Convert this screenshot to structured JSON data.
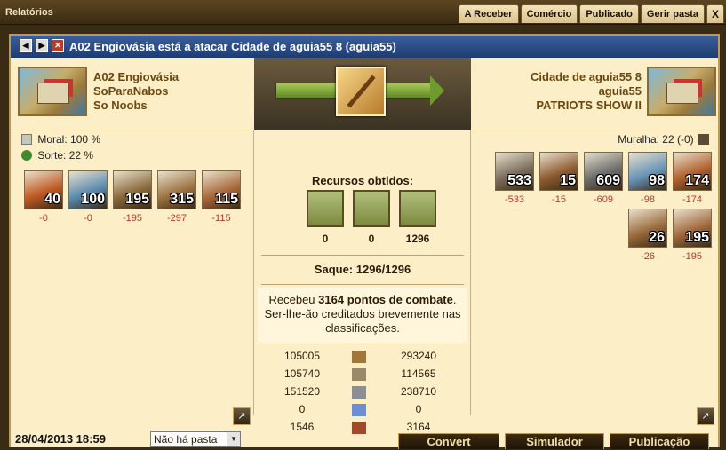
{
  "window": {
    "title": "Relatórios"
  },
  "tabs": [
    "A Receber",
    "Comércio",
    "Publicado",
    "Gerir pasta",
    "X"
  ],
  "report": {
    "title": "A02 Engiovásia está a atacar Cidade de aguia55 8 (aguia55)",
    "nav_prev": "◀",
    "nav_next": "▶",
    "nav_close": "✕"
  },
  "attacker": {
    "city": "A02 Engiovásia",
    "player": "SoParaNabos",
    "alliance": "So Noobs",
    "moral_label": "Moral: 100 %",
    "sorte_label": "Sorte: 22 %",
    "units": [
      {
        "icon": "fire-ship-icon",
        "count": "40",
        "loss": "-0",
        "color": "#c05a24"
      },
      {
        "icon": "transport-boat-icon",
        "count": "100",
        "loss": "-0",
        "color": "#5b8bb0"
      },
      {
        "icon": "hoplite-icon",
        "count": "195",
        "loss": "-195",
        "color": "#8a6a3c"
      },
      {
        "icon": "slinger-icon",
        "count": "315",
        "loss": "-297",
        "color": "#9c7240"
      },
      {
        "icon": "swordsman-icon",
        "count": "115",
        "loss": "-115",
        "color": "#a86a3a"
      }
    ]
  },
  "defender": {
    "city": "Cidade de aguia55 8",
    "player": "aguia55",
    "alliance": "PATRIOTS SHOW II",
    "wall_label": "Muralha: 22 (-0)",
    "units": [
      {
        "icon": "archer-icon",
        "count": "533",
        "loss": "-533",
        "color": "#7a6c5c"
      },
      {
        "icon": "swordsman-icon",
        "count": "15",
        "loss": "-15",
        "color": "#8c5a30"
      },
      {
        "icon": "hoplite-icon",
        "count": "609",
        "loss": "-609",
        "color": "#6c6c6c"
      },
      {
        "icon": "transport-boat-icon",
        "count": "98",
        "loss": "-98",
        "color": "#6a95b8"
      },
      {
        "icon": "fire-ship-icon",
        "count": "174",
        "loss": "-174",
        "color": "#b0602c"
      },
      {
        "icon": "slinger-icon",
        "count": "26",
        "loss": "-26",
        "color": "#9a6a3a"
      },
      {
        "icon": "swordsman-icon",
        "count": "195",
        "loss": "-195",
        "color": "#a0683c"
      }
    ]
  },
  "resources": {
    "title": "Recursos obtidos:",
    "items": [
      {
        "icon": "wood-icon",
        "value": "0"
      },
      {
        "icon": "stone-icon",
        "value": "0"
      },
      {
        "icon": "silver-icon",
        "value": "1296"
      }
    ],
    "loot": "Saque: 1296/1296"
  },
  "points": {
    "prefix": "Recebeu ",
    "value": "3164 pontos de combate",
    "suffix": ". Ser-lhe-ão creditados brevemente nas classificações."
  },
  "stats": [
    {
      "attacker": "105005",
      "icon": "wood-icon",
      "defender": "293240"
    },
    {
      "attacker": "105740",
      "icon": "stone-icon",
      "defender": "114565"
    },
    {
      "attacker": "151520",
      "icon": "silver-icon",
      "defender": "238710"
    },
    {
      "attacker": "0",
      "icon": "favor-icon",
      "defender": "0"
    },
    {
      "attacker": "1546",
      "icon": "population-icon",
      "defender": "3164"
    }
  ],
  "footer": {
    "date": "28/04/2013 18:59",
    "folder": "Não há pasta",
    "buttons": [
      "Convert",
      "Simulador",
      "Publicação"
    ]
  },
  "colors": {
    "accent": "#1d3c73",
    "panel": "#fcefc8",
    "loss": "#b23a2a"
  }
}
